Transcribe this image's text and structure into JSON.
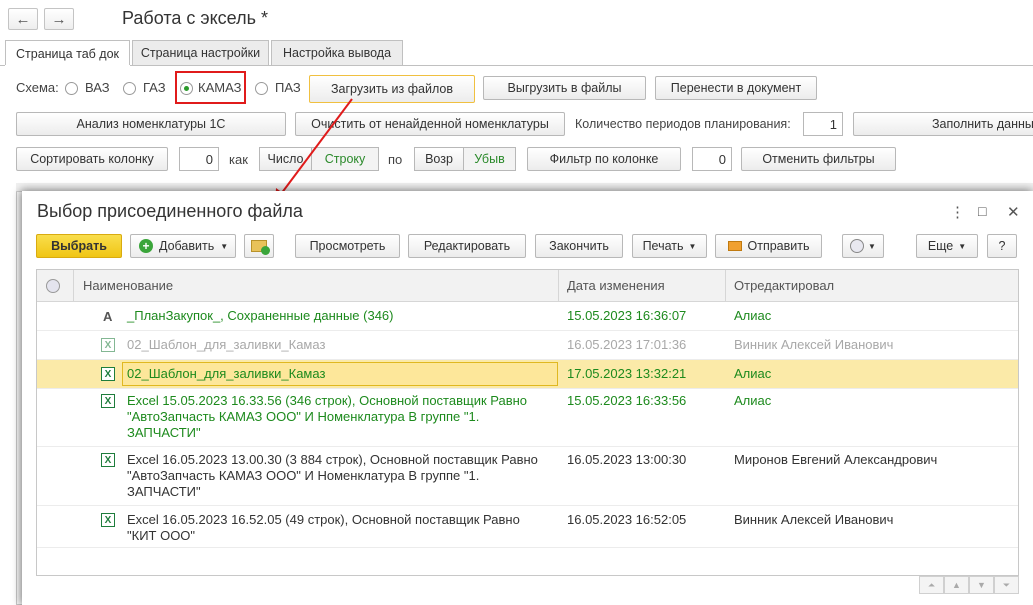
{
  "window": {
    "title": "Работа с эксель *",
    "back_glyph": "←",
    "forward_glyph": "→"
  },
  "tabs": [
    "Страница таб док",
    "Страница настройки",
    "Настройка вывода"
  ],
  "schema": {
    "label": "Схема:",
    "options": [
      "ВАЗ",
      "ГАЗ",
      "КАМАЗ",
      "ПАЗ"
    ],
    "selected": "КАМАЗ",
    "load_button": "Загрузить из файлов",
    "unload_button": "Выгрузить в файлы",
    "transfer_button": "Перенести в документ"
  },
  "row2": {
    "analyze_button": "Анализ номенклатуры 1С",
    "clear_button": "Очистить от ненайденной номенклатуры",
    "periods_label": "Количество периодов планирования:",
    "periods_value": "1",
    "fill_button": "Заполнить данны"
  },
  "row3": {
    "sort_button": "Сортировать колонку",
    "sort_value": "0",
    "how_label": "как",
    "number_option": "Число",
    "string_option": "Строку",
    "by_label": "по",
    "asc_option": "Возр",
    "desc_option": "Убыв",
    "filter_button": "Фильтр по колонке",
    "filter_value": "0",
    "cancel_filters_button": "Отменить фильтры"
  },
  "dialog": {
    "title": "Выбор присоединенного файла",
    "more_glyph": "⋮",
    "maximize_glyph": "□",
    "close_glyph": "✕",
    "toolbar": {
      "select": "Выбрать",
      "add": "Добавить",
      "view": "Просмотреть",
      "edit": "Редактировать",
      "finish": "Закончить",
      "print": "Печать",
      "send": "Отправить",
      "more": "Еще",
      "help": "?"
    },
    "columns": {
      "name": "Наименование",
      "date": "Дата изменения",
      "editor": "Отредактировал"
    },
    "rows": [
      {
        "name": "_ПланЗакупок_, Сохраненные данные (346)",
        "date": "15.05.2023 16:36:07",
        "editor": "Алиас",
        "icon": "text-doc-icon"
      },
      {
        "name": "02_Шаблон_для_заливки_Камаз",
        "date": "16.05.2023 17:01:36",
        "editor": "Винник Алексей Иванович",
        "icon": "excel-icon"
      },
      {
        "name": "02_Шаблон_для_заливки_Камаз",
        "date": "17.05.2023 13:32:21",
        "editor": "Алиас",
        "icon": "excel-icon"
      },
      {
        "name_lines": [
          "Excel 15.05.2023 16.33.56 (346 строк), Основной поставщик Равно",
          "\"АвтоЗапчасть КАМАЗ ООО\" И Номенклатура В группе \"1.",
          "ЗАПЧАСТИ\""
        ],
        "date": "15.05.2023 16:33:56",
        "editor": "Алиас",
        "icon": "excel-icon"
      },
      {
        "name_lines": [
          "Excel 16.05.2023 13.00.30 (3 884 строк), Основной поставщик Равно",
          "\"АвтоЗапчасть КАМАЗ ООО\" И Номенклатура В группе \"1.",
          "ЗАПЧАСТИ\""
        ],
        "date": "16.05.2023 13:00:30",
        "editor": "Миронов Евгений Александрович",
        "icon": "excel-icon"
      },
      {
        "name_lines": [
          "Excel 16.05.2023 16.52.05 (49 строк), Основной поставщик Равно",
          "\"КИТ ООО\""
        ],
        "date": "16.05.2023 16:52:05",
        "editor": "Винник Алексей Иванович",
        "icon": "excel-icon"
      }
    ]
  },
  "colors": {
    "accent_green": "#1d8a1d",
    "highlight_red": "#e01b1b",
    "selected_row": "#fbeaa8",
    "select_button": "#f5cf1c"
  }
}
